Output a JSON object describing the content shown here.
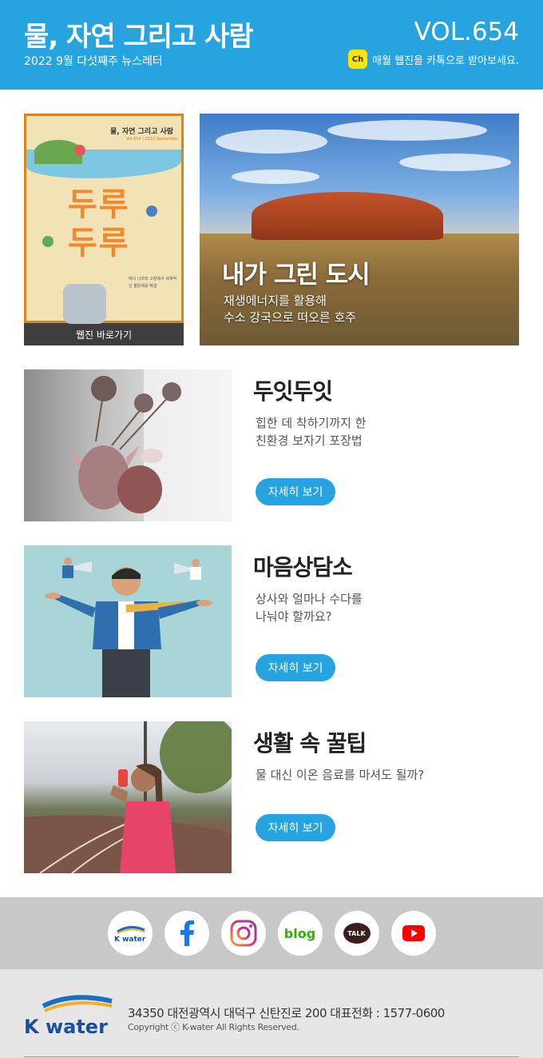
{
  "header": {
    "title": "물, 자연 그리고 사람",
    "subtitle": "2022 9월 다섯째주 뉴스레터",
    "volume": "VOL.654",
    "kakao_badge": "Ch",
    "kakao_text": "매월 웹진을 카톡으로 받아보세요."
  },
  "cover": {
    "top_text": "물, 자연 그리고 사람",
    "sub_text": "Vol.654 | 2022 September",
    "word_1": "두루",
    "word_2": "두루",
    "body_text": "에너 나라와 고장에서 세계적인 물문제를 해결",
    "label": "웹진 바로가기"
  },
  "hero": {
    "title": "내가 그린 도시",
    "desc_line1": "재생에너지를 활용해",
    "desc_line2": "수소 강국으로 떠오른 호주"
  },
  "articles": [
    {
      "title": "두잇두잇",
      "desc_line1": "힙한 데 착하기까지 한",
      "desc_line2": "친환경 보자기 포장법",
      "button": "자세히 보기"
    },
    {
      "title": "마음상담소",
      "desc_line1": "상사와 얼마나 수다를",
      "desc_line2": "나눠야 할까요?",
      "button": "자세히 보기"
    },
    {
      "title": "생활 속 꿀팁",
      "desc_line1": "물 대신 이온 음료를 마셔도 될까?",
      "desc_line2": "",
      "button": "자세히 보기"
    }
  ],
  "social": {
    "kwater_label": "K water",
    "blog_label": "blog",
    "talk_label": "TALK"
  },
  "footer": {
    "logo_text": "K water",
    "address": "34350 대전광역시 대덕구 신탄진로 200   대표전화 : 1577-0600",
    "copyright": "Copyright ⓒ K-water All Rights Reserved."
  },
  "colors": {
    "header_bg": "#27a4df",
    "button_bg": "#27a4df",
    "kakao_yellow": "#fde500"
  }
}
